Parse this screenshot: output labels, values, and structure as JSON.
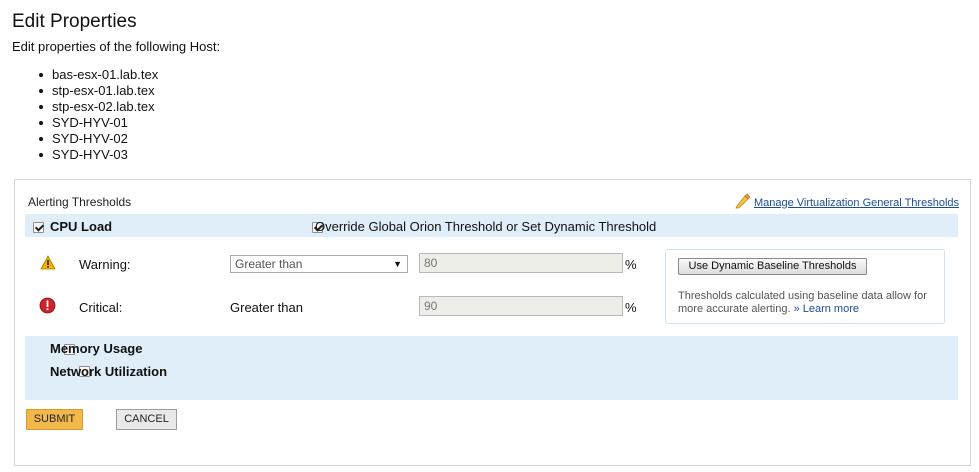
{
  "page": {
    "title": "Edit Properties",
    "subtitle": "Edit properties of the following Host:",
    "hosts": [
      "bas-esx-01.lab.tex",
      "stp-esx-01.lab.tex",
      "stp-esx-02.lab.tex",
      "SYD-HYV-01",
      "SYD-HYV-02",
      "SYD-HYV-03"
    ]
  },
  "thresholds": {
    "section_title": "Alerting Thresholds",
    "manage_link": "Manage Virtualization General Thresholds",
    "manage_icon": "pencil-icon",
    "cpu": {
      "label": "CPU Load",
      "checked": true,
      "override_label": "Override Global Orion Threshold or Set Dynamic Threshold",
      "override_checked": true,
      "warning": {
        "icon": "warning-triangle-icon",
        "label": "Warning:",
        "comparison": "Greater than",
        "value": "80",
        "unit": "%"
      },
      "critical": {
        "icon": "critical-circle-icon",
        "label": "Critical:",
        "comparison": "Greater than",
        "value": "90",
        "unit": "%"
      },
      "dynamic": {
        "button_label": "Use Dynamic Baseline Thresholds",
        "note": "Thresholds calculated using baseline data allow for more accurate alerting.",
        "learn_more": "» Learn more"
      }
    },
    "memory": {
      "label": "Memory Usage",
      "checked": false
    },
    "network": {
      "label": "Network Utilization",
      "checked": false
    }
  },
  "actions": {
    "submit_label": "SUBMIT",
    "cancel_label": "CANCEL"
  },
  "colors": {
    "band": "#dfeef8",
    "submit": "#f2b94a",
    "link": "#1c4d9a",
    "warning": "#f0b400",
    "critical": "#c9252c"
  }
}
